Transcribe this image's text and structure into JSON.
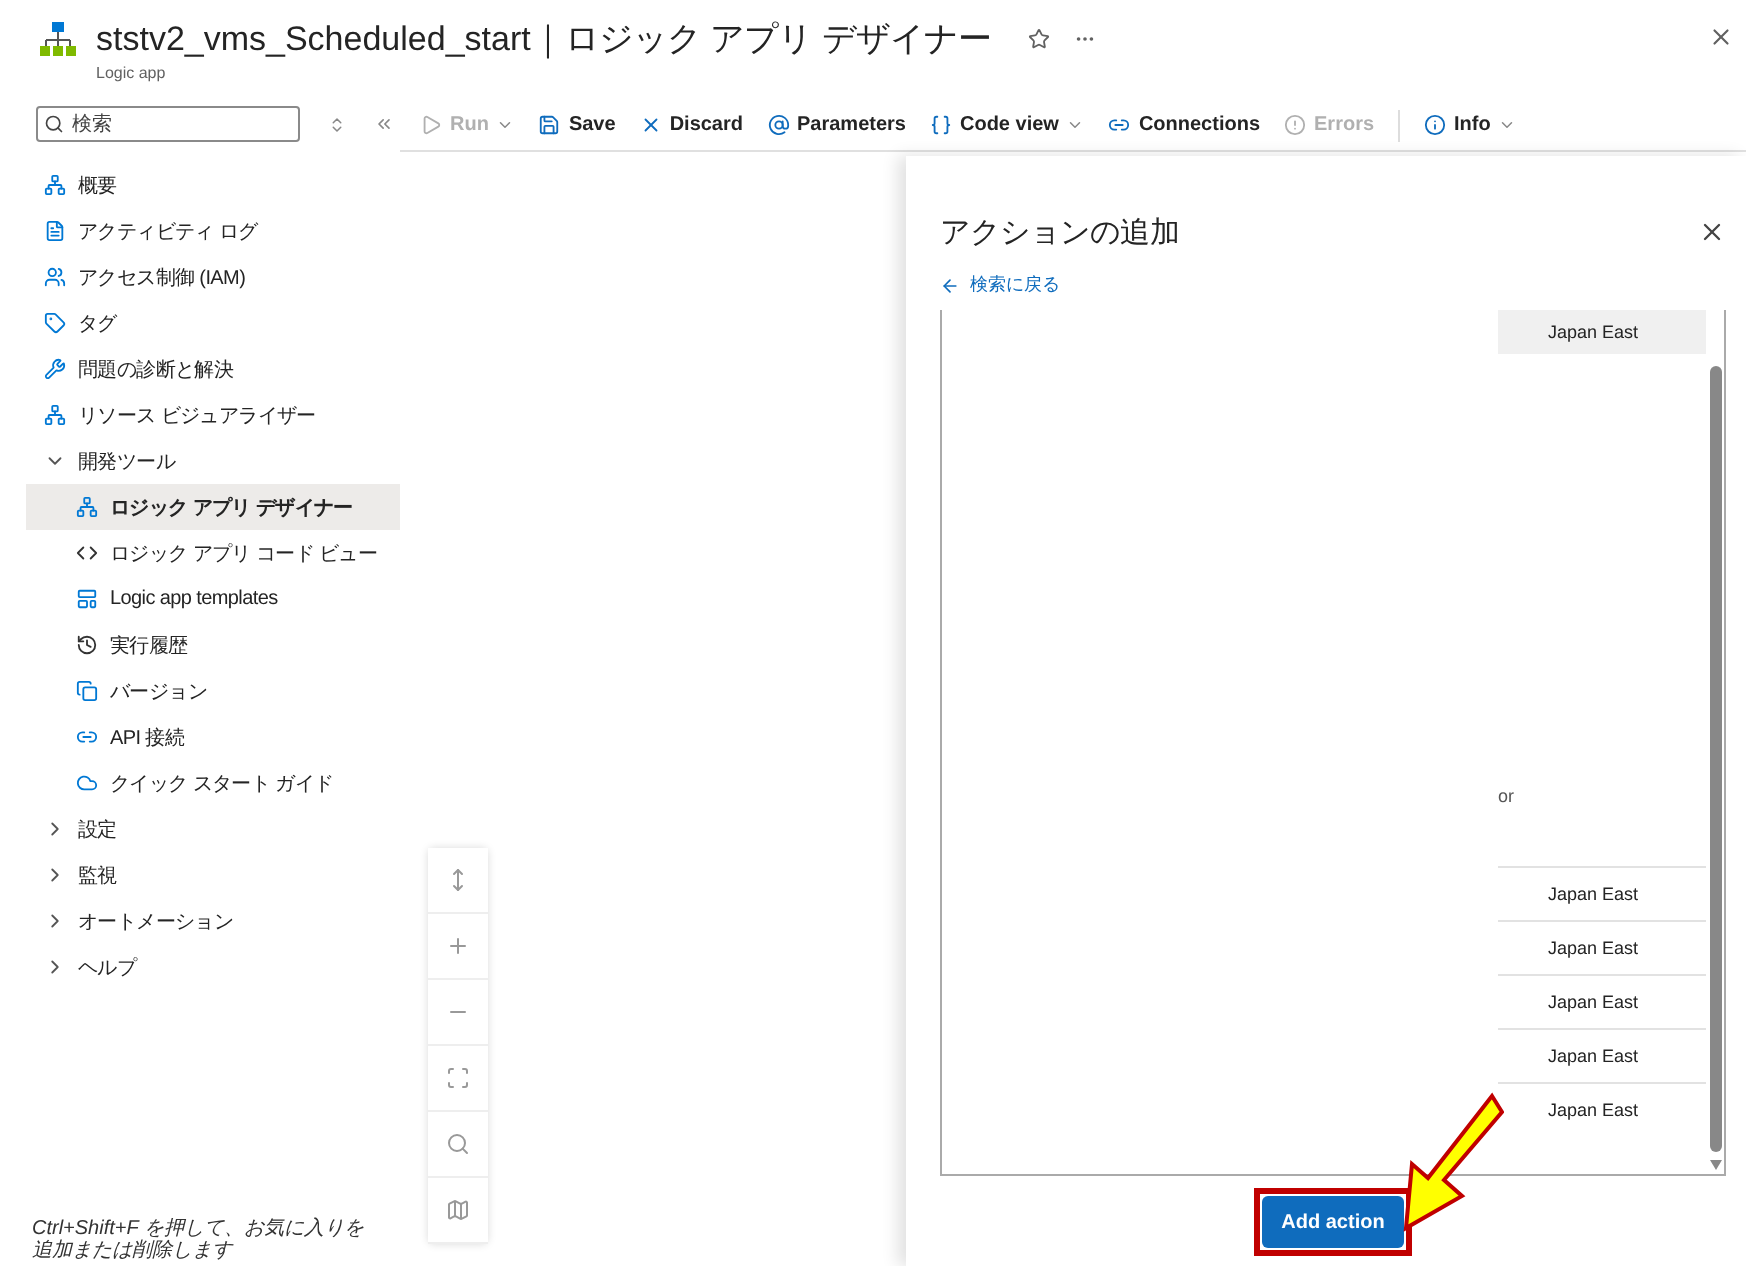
{
  "header": {
    "title": "ststv2_vms_Scheduled_start｜ロジック アプリ デザイナー",
    "subtitle": "Logic app"
  },
  "sidebar": {
    "search": {
      "placeholder": "検索"
    },
    "items": [
      {
        "kind": "link",
        "label": "概要",
        "selected": false
      },
      {
        "kind": "link",
        "label": "アクティビティ ログ",
        "selected": false
      },
      {
        "kind": "link",
        "label": "アクセス制御 (IAM)",
        "selected": false
      },
      {
        "kind": "link",
        "label": "タグ",
        "selected": false
      },
      {
        "kind": "link",
        "label": "問題の診断と解決",
        "selected": false
      },
      {
        "kind": "link",
        "label": "リソース ビジュアライザー",
        "selected": false
      },
      {
        "kind": "group",
        "label": "開発ツール",
        "expanded": true,
        "children": [
          {
            "label": "ロジック アプリ デザイナー",
            "selected": true
          },
          {
            "label": "ロジック アプリ コード ビュー",
            "selected": false
          },
          {
            "label": "Logic app templates",
            "selected": false
          },
          {
            "label": "実行履歴",
            "selected": false
          },
          {
            "label": "バージョン",
            "selected": false
          },
          {
            "label": "API 接続",
            "selected": false
          },
          {
            "label": "クイック スタート ガイド",
            "selected": false
          }
        ]
      },
      {
        "kind": "group",
        "label": "設定",
        "expanded": false
      },
      {
        "kind": "group",
        "label": "監視",
        "expanded": false
      },
      {
        "kind": "group",
        "label": "オートメーション",
        "expanded": false
      },
      {
        "kind": "group",
        "label": "ヘルプ",
        "expanded": false
      }
    ],
    "hint": "Ctrl+Shift+F を押して、お気に入りを追加または削除します"
  },
  "toolbar": [
    {
      "label": "Run",
      "disabled": true,
      "dropdown": true
    },
    {
      "label": "Save",
      "disabled": false,
      "dropdown": false
    },
    {
      "label": "Discard",
      "disabled": false,
      "dropdown": false
    },
    {
      "label": "Parameters",
      "disabled": false,
      "dropdown": false
    },
    {
      "label": "Code view",
      "disabled": false,
      "dropdown": true
    },
    {
      "label": "Connections",
      "disabled": false,
      "dropdown": false
    },
    {
      "label": "Errors",
      "disabled": true,
      "dropdown": false
    },
    {
      "label": "Info",
      "disabled": false,
      "dropdown": true
    }
  ],
  "panel": {
    "title": "アクションの追加",
    "back_link": "検索に戻る",
    "list": [
      {
        "kind": "cell",
        "text": "Japan East",
        "selected": true
      },
      {
        "kind": "note",
        "text": "or"
      },
      {
        "kind": "cell",
        "text": "Japan East",
        "selected": false
      },
      {
        "kind": "cell",
        "text": "Japan East",
        "selected": false
      },
      {
        "kind": "cell",
        "text": "Japan East",
        "selected": false
      },
      {
        "kind": "cell",
        "text": "Japan East",
        "selected": false
      },
      {
        "kind": "cell",
        "text": "Japan East",
        "selected": false
      }
    ],
    "button": "Add action"
  }
}
